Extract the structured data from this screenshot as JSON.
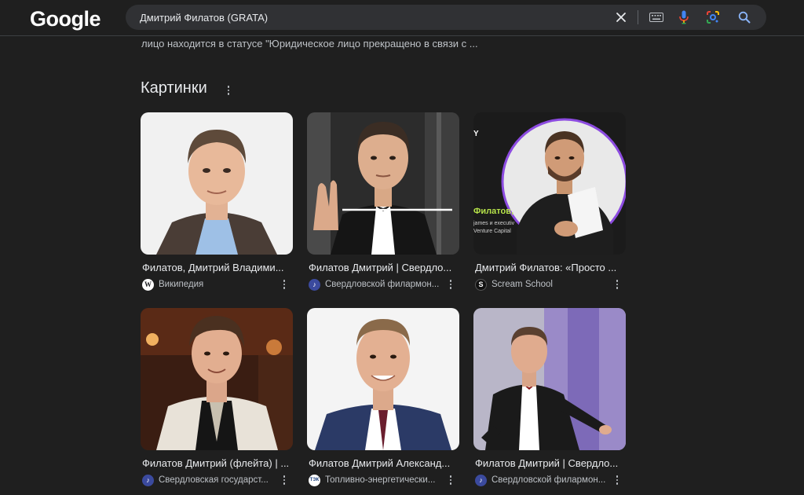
{
  "header": {
    "logo": "Google",
    "search_query": "Дмитрий Филатов (GRATA)"
  },
  "snippet": "лицо находится в статусе \"Юридическое лицо прекращено в связи с ...",
  "images_section": {
    "title": "Картинки",
    "cards": [
      {
        "title": "Филатов, Дмитрий Владими...",
        "source": "Википедия",
        "favicon": "wikipedia-icon"
      },
      {
        "title": "Филатов Дмитрий | Свердло...",
        "source": "Свердловской филармон...",
        "favicon": "music-note-icon"
      },
      {
        "title": "Дмитрий Филатов: «Просто ...",
        "source": "Scream School",
        "favicon": "scream-school-icon"
      },
      {
        "title": "Филатов Дмитрий (флейта) | ...",
        "source": "Свердловская государст...",
        "favicon": "music-note-icon"
      },
      {
        "title": "Филатов Дмитрий Александ...",
        "source": "Топливно-энергетически...",
        "favicon": "energy-icon"
      },
      {
        "title": "Филатов Дмитрий | Свердло...",
        "source": "Свердловской филармон...",
        "favicon": "music-note-icon"
      }
    ],
    "thumb3_overlay": {
      "line1": "Y",
      "line2": "Филатов,",
      "line3": "james и executiv",
      "line4": "Venture Capital"
    }
  },
  "colors": {
    "background": "#1f1f1f",
    "search_bg": "#303134",
    "text_primary": "#e8eaed",
    "text_secondary": "#bdc1c6"
  }
}
